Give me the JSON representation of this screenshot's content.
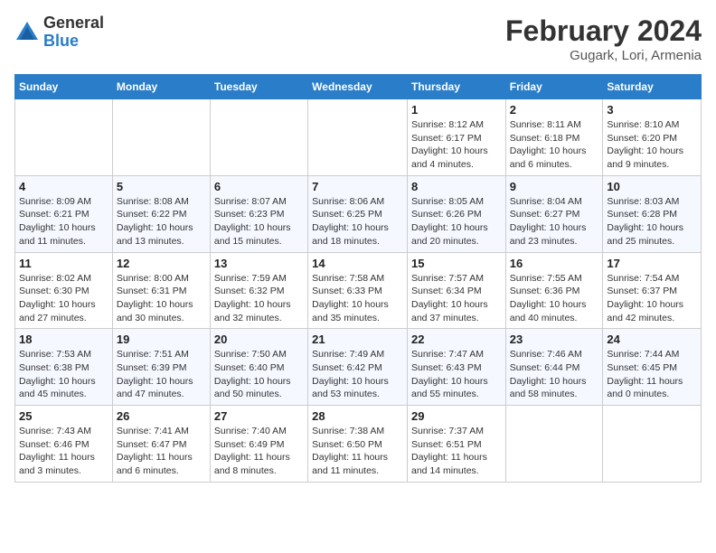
{
  "logo": {
    "general": "General",
    "blue": "Blue"
  },
  "title": "February 2024",
  "subtitle": "Gugark, Lori, Armenia",
  "days_of_week": [
    "Sunday",
    "Monday",
    "Tuesday",
    "Wednesday",
    "Thursday",
    "Friday",
    "Saturday"
  ],
  "weeks": [
    [
      {
        "num": "",
        "info": ""
      },
      {
        "num": "",
        "info": ""
      },
      {
        "num": "",
        "info": ""
      },
      {
        "num": "",
        "info": ""
      },
      {
        "num": "1",
        "info": "Sunrise: 8:12 AM\nSunset: 6:17 PM\nDaylight: 10 hours\nand 4 minutes."
      },
      {
        "num": "2",
        "info": "Sunrise: 8:11 AM\nSunset: 6:18 PM\nDaylight: 10 hours\nand 6 minutes."
      },
      {
        "num": "3",
        "info": "Sunrise: 8:10 AM\nSunset: 6:20 PM\nDaylight: 10 hours\nand 9 minutes."
      }
    ],
    [
      {
        "num": "4",
        "info": "Sunrise: 8:09 AM\nSunset: 6:21 PM\nDaylight: 10 hours\nand 11 minutes."
      },
      {
        "num": "5",
        "info": "Sunrise: 8:08 AM\nSunset: 6:22 PM\nDaylight: 10 hours\nand 13 minutes."
      },
      {
        "num": "6",
        "info": "Sunrise: 8:07 AM\nSunset: 6:23 PM\nDaylight: 10 hours\nand 15 minutes."
      },
      {
        "num": "7",
        "info": "Sunrise: 8:06 AM\nSunset: 6:25 PM\nDaylight: 10 hours\nand 18 minutes."
      },
      {
        "num": "8",
        "info": "Sunrise: 8:05 AM\nSunset: 6:26 PM\nDaylight: 10 hours\nand 20 minutes."
      },
      {
        "num": "9",
        "info": "Sunrise: 8:04 AM\nSunset: 6:27 PM\nDaylight: 10 hours\nand 23 minutes."
      },
      {
        "num": "10",
        "info": "Sunrise: 8:03 AM\nSunset: 6:28 PM\nDaylight: 10 hours\nand 25 minutes."
      }
    ],
    [
      {
        "num": "11",
        "info": "Sunrise: 8:02 AM\nSunset: 6:30 PM\nDaylight: 10 hours\nand 27 minutes."
      },
      {
        "num": "12",
        "info": "Sunrise: 8:00 AM\nSunset: 6:31 PM\nDaylight: 10 hours\nand 30 minutes."
      },
      {
        "num": "13",
        "info": "Sunrise: 7:59 AM\nSunset: 6:32 PM\nDaylight: 10 hours\nand 32 minutes."
      },
      {
        "num": "14",
        "info": "Sunrise: 7:58 AM\nSunset: 6:33 PM\nDaylight: 10 hours\nand 35 minutes."
      },
      {
        "num": "15",
        "info": "Sunrise: 7:57 AM\nSunset: 6:34 PM\nDaylight: 10 hours\nand 37 minutes."
      },
      {
        "num": "16",
        "info": "Sunrise: 7:55 AM\nSunset: 6:36 PM\nDaylight: 10 hours\nand 40 minutes."
      },
      {
        "num": "17",
        "info": "Sunrise: 7:54 AM\nSunset: 6:37 PM\nDaylight: 10 hours\nand 42 minutes."
      }
    ],
    [
      {
        "num": "18",
        "info": "Sunrise: 7:53 AM\nSunset: 6:38 PM\nDaylight: 10 hours\nand 45 minutes."
      },
      {
        "num": "19",
        "info": "Sunrise: 7:51 AM\nSunset: 6:39 PM\nDaylight: 10 hours\nand 47 minutes."
      },
      {
        "num": "20",
        "info": "Sunrise: 7:50 AM\nSunset: 6:40 PM\nDaylight: 10 hours\nand 50 minutes."
      },
      {
        "num": "21",
        "info": "Sunrise: 7:49 AM\nSunset: 6:42 PM\nDaylight: 10 hours\nand 53 minutes."
      },
      {
        "num": "22",
        "info": "Sunrise: 7:47 AM\nSunset: 6:43 PM\nDaylight: 10 hours\nand 55 minutes."
      },
      {
        "num": "23",
        "info": "Sunrise: 7:46 AM\nSunset: 6:44 PM\nDaylight: 10 hours\nand 58 minutes."
      },
      {
        "num": "24",
        "info": "Sunrise: 7:44 AM\nSunset: 6:45 PM\nDaylight: 11 hours\nand 0 minutes."
      }
    ],
    [
      {
        "num": "25",
        "info": "Sunrise: 7:43 AM\nSunset: 6:46 PM\nDaylight: 11 hours\nand 3 minutes."
      },
      {
        "num": "26",
        "info": "Sunrise: 7:41 AM\nSunset: 6:47 PM\nDaylight: 11 hours\nand 6 minutes."
      },
      {
        "num": "27",
        "info": "Sunrise: 7:40 AM\nSunset: 6:49 PM\nDaylight: 11 hours\nand 8 minutes."
      },
      {
        "num": "28",
        "info": "Sunrise: 7:38 AM\nSunset: 6:50 PM\nDaylight: 11 hours\nand 11 minutes."
      },
      {
        "num": "29",
        "info": "Sunrise: 7:37 AM\nSunset: 6:51 PM\nDaylight: 11 hours\nand 14 minutes."
      },
      {
        "num": "",
        "info": ""
      },
      {
        "num": "",
        "info": ""
      }
    ]
  ]
}
